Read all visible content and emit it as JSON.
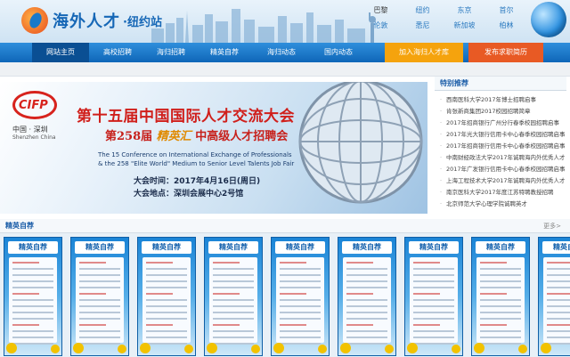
{
  "logo": {
    "text": "海外人才",
    "sub": "·纽约站"
  },
  "cities": [
    "巴黎",
    "纽约",
    "东京",
    "首尔",
    "伦敦",
    "悉尼",
    "新加坡",
    "柏林"
  ],
  "active_city_index": 0,
  "nav": {
    "items": [
      "网站主页",
      "高校招聘",
      "海归招聘",
      "精英自荐",
      "海归动态",
      "国内动态"
    ],
    "apply": "加入海归人才库",
    "post": "发布求职简历"
  },
  "banner": {
    "logo": "CIFP",
    "city_cn": "中国 · 深圳",
    "city_en": "Shenzhen China",
    "title": "第十五届中国国际人才交流大会",
    "sub_prefix": "第258届",
    "sub_accent": "精英汇",
    "sub_suffix": "中高级人才招聘会",
    "en_line1": "The 15 Conference on International Exchange of Professionals",
    "en_line2": "& the 258 \"Elite World\" Medium to Senior Level Talents Job Fair",
    "time": "大会时间：2017年4月16日(周日)",
    "place": "大会地点：深圳会展中心2号馆"
  },
  "special": {
    "title": "特别推荐",
    "items": [
      "西南医科大学2017年博士招聘启事",
      "肯张新商集团2017校园招聘简章",
      "2017年招商银行广州分行春季校园招聘启事",
      "2017年光大银行信用卡中心春季校园招聘启事",
      "2017年招商银行信用卡中心春季校园招聘启事",
      "中南财经政法大学2017年诚聘海内外优秀人才",
      "2017年广发银行信用卡中心春季校园招聘启事",
      "上海工程技术大学2017年诚聘海内外优秀人才",
      "南京医科大学2017年度江苏特聘教授招聘",
      "北京师范大学心理学院诚聘英才"
    ]
  },
  "elite": {
    "title": "精英自荐",
    "more": "更多>",
    "card_title": "精英自荐",
    "card_count": 9
  },
  "colors": {
    "nav_blue": "#0f66b8",
    "apply_orange": "#f5a30d",
    "post_orange": "#e85a24",
    "banner_red": "#d01f1b"
  }
}
